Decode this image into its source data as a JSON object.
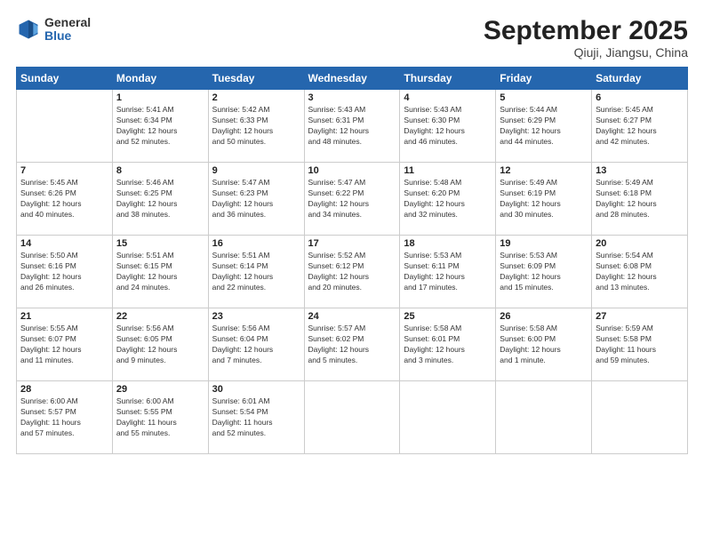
{
  "logo": {
    "general": "General",
    "blue": "Blue"
  },
  "title": "September 2025",
  "subtitle": "Qiuji, Jiangsu, China",
  "days": [
    "Sunday",
    "Monday",
    "Tuesday",
    "Wednesday",
    "Thursday",
    "Friday",
    "Saturday"
  ],
  "weeks": [
    [
      {
        "num": "",
        "info": ""
      },
      {
        "num": "1",
        "info": "Sunrise: 5:41 AM\nSunset: 6:34 PM\nDaylight: 12 hours\nand 52 minutes."
      },
      {
        "num": "2",
        "info": "Sunrise: 5:42 AM\nSunset: 6:33 PM\nDaylight: 12 hours\nand 50 minutes."
      },
      {
        "num": "3",
        "info": "Sunrise: 5:43 AM\nSunset: 6:31 PM\nDaylight: 12 hours\nand 48 minutes."
      },
      {
        "num": "4",
        "info": "Sunrise: 5:43 AM\nSunset: 6:30 PM\nDaylight: 12 hours\nand 46 minutes."
      },
      {
        "num": "5",
        "info": "Sunrise: 5:44 AM\nSunset: 6:29 PM\nDaylight: 12 hours\nand 44 minutes."
      },
      {
        "num": "6",
        "info": "Sunrise: 5:45 AM\nSunset: 6:27 PM\nDaylight: 12 hours\nand 42 minutes."
      }
    ],
    [
      {
        "num": "7",
        "info": "Sunrise: 5:45 AM\nSunset: 6:26 PM\nDaylight: 12 hours\nand 40 minutes."
      },
      {
        "num": "8",
        "info": "Sunrise: 5:46 AM\nSunset: 6:25 PM\nDaylight: 12 hours\nand 38 minutes."
      },
      {
        "num": "9",
        "info": "Sunrise: 5:47 AM\nSunset: 6:23 PM\nDaylight: 12 hours\nand 36 minutes."
      },
      {
        "num": "10",
        "info": "Sunrise: 5:47 AM\nSunset: 6:22 PM\nDaylight: 12 hours\nand 34 minutes."
      },
      {
        "num": "11",
        "info": "Sunrise: 5:48 AM\nSunset: 6:20 PM\nDaylight: 12 hours\nand 32 minutes."
      },
      {
        "num": "12",
        "info": "Sunrise: 5:49 AM\nSunset: 6:19 PM\nDaylight: 12 hours\nand 30 minutes."
      },
      {
        "num": "13",
        "info": "Sunrise: 5:49 AM\nSunset: 6:18 PM\nDaylight: 12 hours\nand 28 minutes."
      }
    ],
    [
      {
        "num": "14",
        "info": "Sunrise: 5:50 AM\nSunset: 6:16 PM\nDaylight: 12 hours\nand 26 minutes."
      },
      {
        "num": "15",
        "info": "Sunrise: 5:51 AM\nSunset: 6:15 PM\nDaylight: 12 hours\nand 24 minutes."
      },
      {
        "num": "16",
        "info": "Sunrise: 5:51 AM\nSunset: 6:14 PM\nDaylight: 12 hours\nand 22 minutes."
      },
      {
        "num": "17",
        "info": "Sunrise: 5:52 AM\nSunset: 6:12 PM\nDaylight: 12 hours\nand 20 minutes."
      },
      {
        "num": "18",
        "info": "Sunrise: 5:53 AM\nSunset: 6:11 PM\nDaylight: 12 hours\nand 17 minutes."
      },
      {
        "num": "19",
        "info": "Sunrise: 5:53 AM\nSunset: 6:09 PM\nDaylight: 12 hours\nand 15 minutes."
      },
      {
        "num": "20",
        "info": "Sunrise: 5:54 AM\nSunset: 6:08 PM\nDaylight: 12 hours\nand 13 minutes."
      }
    ],
    [
      {
        "num": "21",
        "info": "Sunrise: 5:55 AM\nSunset: 6:07 PM\nDaylight: 12 hours\nand 11 minutes."
      },
      {
        "num": "22",
        "info": "Sunrise: 5:56 AM\nSunset: 6:05 PM\nDaylight: 12 hours\nand 9 minutes."
      },
      {
        "num": "23",
        "info": "Sunrise: 5:56 AM\nSunset: 6:04 PM\nDaylight: 12 hours\nand 7 minutes."
      },
      {
        "num": "24",
        "info": "Sunrise: 5:57 AM\nSunset: 6:02 PM\nDaylight: 12 hours\nand 5 minutes."
      },
      {
        "num": "25",
        "info": "Sunrise: 5:58 AM\nSunset: 6:01 PM\nDaylight: 12 hours\nand 3 minutes."
      },
      {
        "num": "26",
        "info": "Sunrise: 5:58 AM\nSunset: 6:00 PM\nDaylight: 12 hours\nand 1 minute."
      },
      {
        "num": "27",
        "info": "Sunrise: 5:59 AM\nSunset: 5:58 PM\nDaylight: 11 hours\nand 59 minutes."
      }
    ],
    [
      {
        "num": "28",
        "info": "Sunrise: 6:00 AM\nSunset: 5:57 PM\nDaylight: 11 hours\nand 57 minutes."
      },
      {
        "num": "29",
        "info": "Sunrise: 6:00 AM\nSunset: 5:55 PM\nDaylight: 11 hours\nand 55 minutes."
      },
      {
        "num": "30",
        "info": "Sunrise: 6:01 AM\nSunset: 5:54 PM\nDaylight: 11 hours\nand 52 minutes."
      },
      {
        "num": "",
        "info": ""
      },
      {
        "num": "",
        "info": ""
      },
      {
        "num": "",
        "info": ""
      },
      {
        "num": "",
        "info": ""
      }
    ]
  ]
}
